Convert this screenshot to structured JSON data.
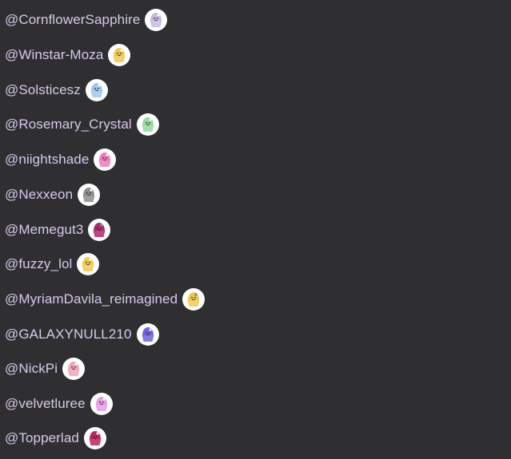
{
  "users": [
    {
      "handle": "@CornflowerSapphire",
      "avatar_icon": "cupcake-icon",
      "color": "#c9b8de",
      "accent": "#ffffff"
    },
    {
      "handle": "@Winstar-Moza",
      "avatar_icon": "cupcake-icon",
      "color": "#f2c84b",
      "accent": "#ffffff"
    },
    {
      "handle": "@Solsticesz",
      "avatar_icon": "cupcake-icon",
      "color": "#9ec9ec",
      "accent": "#ffffff"
    },
    {
      "handle": "@Rosemary_Crystal",
      "avatar_icon": "cupcake-icon",
      "color": "#8fdc9a",
      "accent": "#ffffff"
    },
    {
      "handle": "@niightshade",
      "avatar_icon": "cupcake-icon",
      "color": "#f07ab8",
      "accent": "#ffffff"
    },
    {
      "handle": "@Nexxeon",
      "avatar_icon": "cupcake-icon",
      "color": "#8c8c8c",
      "accent": "#ffffff"
    },
    {
      "handle": "@Memegut3",
      "avatar_icon": "cupcake-icon",
      "color": "#b0286e",
      "accent": "#4ad36a"
    },
    {
      "handle": "@fuzzy_lol",
      "avatar_icon": "cupcake-icon",
      "color": "#f2c84b",
      "accent": "#ffffff"
    },
    {
      "handle": "@MyriamDavila_reimagined",
      "avatar_icon": "cupcake-icon",
      "color": "#f2c84b",
      "accent": "#3a7fd6"
    },
    {
      "handle": "@GALAXYNULL210",
      "avatar_icon": "cupcake-icon",
      "color": "#6f63e0",
      "accent": "#ffffff"
    },
    {
      "handle": "@NickPi",
      "avatar_icon": "cupcake-icon",
      "color": "#f0a7b8",
      "accent": "#ffffff"
    },
    {
      "handle": "@velvetluree",
      "avatar_icon": "cupcake-icon",
      "color": "#e79be8",
      "accent": "#ffffff"
    },
    {
      "handle": "@Topperlad",
      "avatar_icon": "cupcake-icon",
      "color": "#c0255e",
      "accent": "#ffffff"
    }
  ]
}
